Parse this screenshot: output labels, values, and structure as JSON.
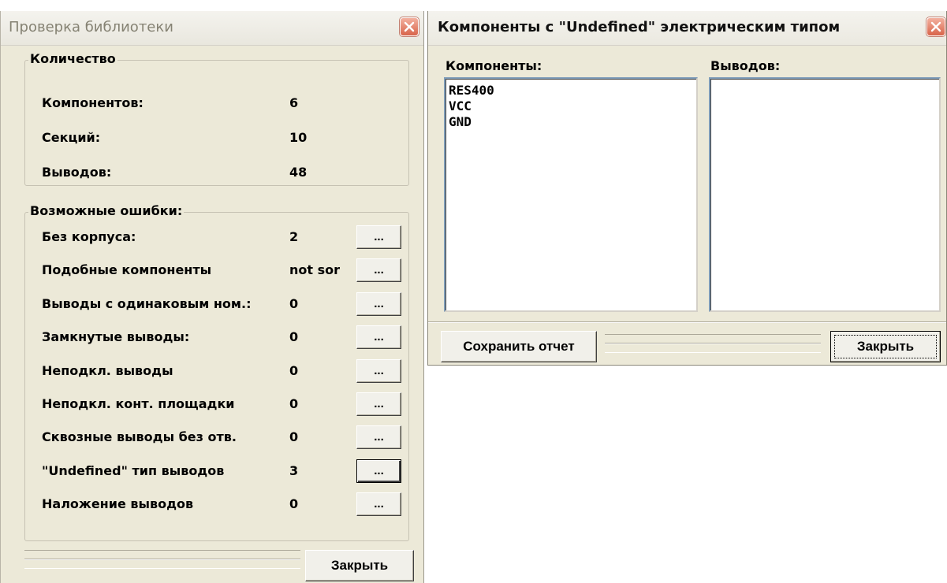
{
  "library_check": {
    "title": "Проверка библиотеки",
    "quantity": {
      "title": "Количество",
      "rows": [
        {
          "label": "Компонентов:",
          "value": "6"
        },
        {
          "label": "Секций:",
          "value": "10"
        },
        {
          "label": "Выводов:",
          "value": "48"
        }
      ]
    },
    "errors": {
      "title": "Возможные ошибки:",
      "button_label": "...",
      "rows": [
        {
          "label": "Без корпуса:",
          "value": "2"
        },
        {
          "label": "Подобные компоненты",
          "value": "not sor"
        },
        {
          "label": "Выводы с одинаковым ном.:",
          "value": "0"
        },
        {
          "label": "Замкнутые выводы:",
          "value": "0"
        },
        {
          "label": "Неподкл. выводы",
          "value": "0"
        },
        {
          "label": "Неподкл. конт. площадки",
          "value": "0"
        },
        {
          "label": "Сквозные выводы без отв.",
          "value": "0"
        },
        {
          "label": "\"Undefined\" тип выводов",
          "value": "3"
        },
        {
          "label": "Наложение выводов",
          "value": "0"
        }
      ]
    },
    "close_label": "Закрыть"
  },
  "undefined_components": {
    "title": "Компоненты с \"Undefined\" электрическим типом",
    "components_label": "Компоненты:",
    "components": [
      "RES400",
      "VCC",
      "GND"
    ],
    "pins_label": "Выводов:",
    "pins": [],
    "save_report_label": "Сохранить отчет",
    "close_label": "Закрыть"
  }
}
